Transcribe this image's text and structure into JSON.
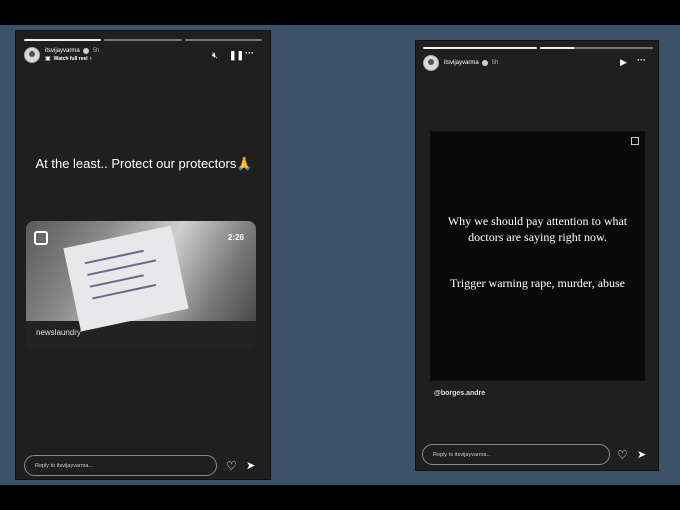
{
  "stories": [
    {
      "username": "itsvijayvarma",
      "time": "5h",
      "subtitle": "Watch full reel",
      "progress": [
        1.0,
        0.0,
        0.0
      ],
      "quote": "At the least.. Protect our protectors🙏",
      "reel": {
        "duration": "2:26",
        "source": "newslaundry"
      },
      "reply_placeholder": "Reply to itsvijayvarma...",
      "icons": {
        "mute": "mute-icon",
        "pause": "pause-icon",
        "more": "more-icon",
        "like": "heart-icon",
        "share": "send-icon"
      }
    },
    {
      "username": "itsvijayvarma",
      "time": "5h",
      "progress": [
        1.0,
        0.3
      ],
      "card_text_1": "Why we should pay attention to what doctors are saying right now.",
      "card_text_2": "Trigger warning rape, murder, abuse",
      "credit": "@borges.andre",
      "reply_placeholder": "Reply to itsvijayvarma...",
      "icons": {
        "play": "play-icon",
        "more": "more-icon",
        "like": "heart-icon",
        "share": "send-icon"
      }
    }
  ]
}
